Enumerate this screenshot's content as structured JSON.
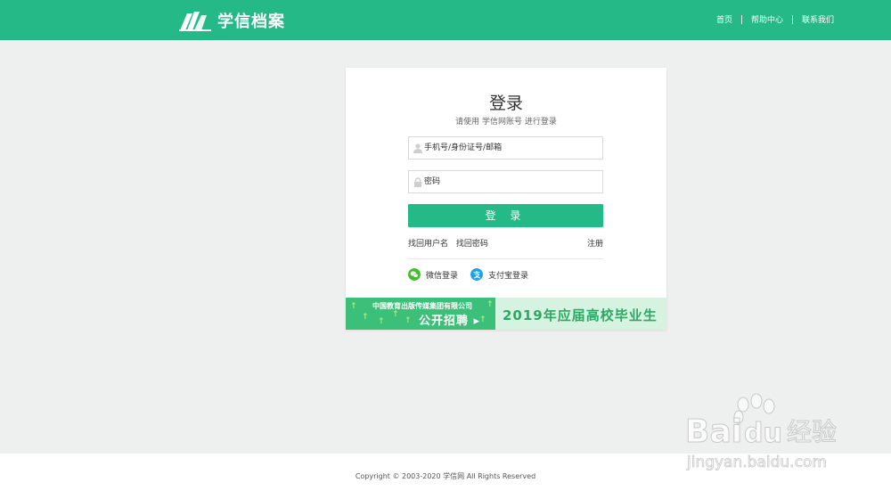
{
  "header": {
    "brand": "学信档案",
    "nav": [
      "首页",
      "帮助中心",
      "联系我们"
    ]
  },
  "login": {
    "title": "登录",
    "subtitle": "请使用 学信网账号 进行登录",
    "username_placeholder": "手机号/身份证号/邮箱",
    "password_placeholder": "密码",
    "button": "登 录",
    "find_username": "找回用户名",
    "find_password": "找回密码",
    "register": "注册",
    "wechat": "微信登录",
    "alipay": "支付宝登录"
  },
  "banner": {
    "line1": "中国教育出版传媒集团有限公司",
    "line2": "公开招聘 ▸",
    "line3": "2019年应届高校毕业生"
  },
  "footer": {
    "copyright": "Copyright © 2003-2020 学信网 All Rights Reserved"
  },
  "watermark": {
    "brand": "Bai du 经验",
    "url": "jingyan.baidu.com"
  },
  "colors": {
    "brand_green": "#25b987",
    "wechat_green": "#3fbf2a",
    "alipay_blue": "#1ea0e8"
  }
}
